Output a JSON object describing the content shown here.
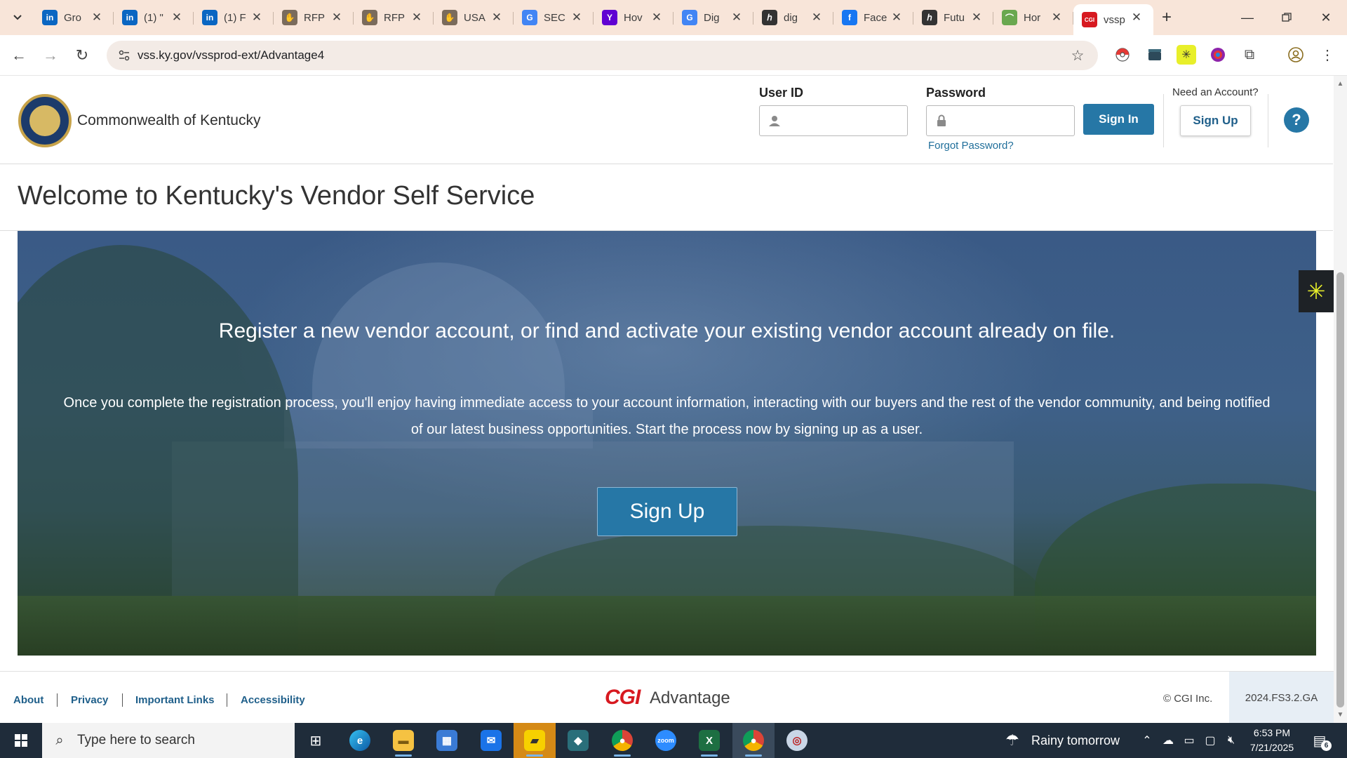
{
  "browser": {
    "tabs": [
      {
        "title": "Gro",
        "icon": "linkedin-icon",
        "glyph": "in",
        "color": "#0a66c2",
        "active": false
      },
      {
        "title": "(1) \"",
        "icon": "linkedin-icon",
        "glyph": "in",
        "color": "#0a66c2",
        "active": false
      },
      {
        "title": "(1) F",
        "icon": "linkedin-icon",
        "glyph": "in",
        "color": "#0a66c2",
        "active": false
      },
      {
        "title": "RFP",
        "icon": "handshake-icon",
        "glyph": "✋",
        "color": "#7a6b5c",
        "active": false
      },
      {
        "title": "RFP",
        "icon": "handshake-icon",
        "glyph": "✋",
        "color": "#7a6b5c",
        "active": false
      },
      {
        "title": "USA",
        "icon": "handshake-icon",
        "glyph": "✋",
        "color": "#7a6b5c",
        "active": false
      },
      {
        "title": "SEC",
        "icon": "google-icon",
        "glyph": "G",
        "color": "#4285f4",
        "active": false
      },
      {
        "title": "Hov",
        "icon": "yahoo-icon",
        "glyph": "Y",
        "color": "#6001d2",
        "active": false
      },
      {
        "title": "Dig",
        "icon": "google-icon",
        "glyph": "G",
        "color": "#4285f4",
        "active": false
      },
      {
        "title": "dig",
        "icon": "feather-icon",
        "glyph": "ℎ",
        "color": "#333333",
        "active": false
      },
      {
        "title": "Face",
        "icon": "facebook-icon",
        "glyph": "f",
        "color": "#1877f2",
        "active": false
      },
      {
        "title": "Futu",
        "icon": "feather-icon",
        "glyph": "ℎ",
        "color": "#333333",
        "active": false
      },
      {
        "title": "Hor",
        "icon": "leaf-icon",
        "glyph": "⌒",
        "color": "#6aa84f",
        "active": false
      },
      {
        "title": "vssp",
        "icon": "cgi-icon",
        "glyph": "CGI",
        "color": "#d71920",
        "active": true
      }
    ],
    "url": "vss.ky.gov/vssprod-ext/Advantage4"
  },
  "header": {
    "org_name": "Commonwealth of Kentucky",
    "user_id_label": "User ID",
    "user_id_value": "",
    "password_label": "Password",
    "password_value": "",
    "forgot_password": "Forgot Password?",
    "sign_in": "Sign In",
    "need_account": "Need an Account?",
    "sign_up": "Sign Up",
    "help": "?"
  },
  "welcome_title": "Welcome to Kentucky's Vendor Self Service",
  "hero": {
    "headline": "Register a new vendor account, or find and activate your existing vendor account already on file.",
    "body": "Once you complete the registration process, you'll enjoy having immediate access to your account information, interacting with our buyers and the rest of the vendor community, and being notified of our latest business opportunities. Start the process now by signing up as a user.",
    "sign_up": "Sign Up"
  },
  "footer": {
    "links": [
      "About",
      "Privacy",
      "Important Links",
      "Accessibility"
    ],
    "brand": "CGI",
    "product": "Advantage",
    "copyright": "© CGI Inc.",
    "version": "2024.FS3.2.GA"
  },
  "taskbar": {
    "search_placeholder": "Type here to search",
    "weather": "Rainy tomorrow",
    "time": "6:53 PM",
    "date": "7/21/2025",
    "notifications": "6"
  },
  "colors": {
    "accent": "#2677a6",
    "link": "#1f5f8a",
    "cgi_red": "#d71920",
    "tabstrip": "#f8e5d9"
  }
}
